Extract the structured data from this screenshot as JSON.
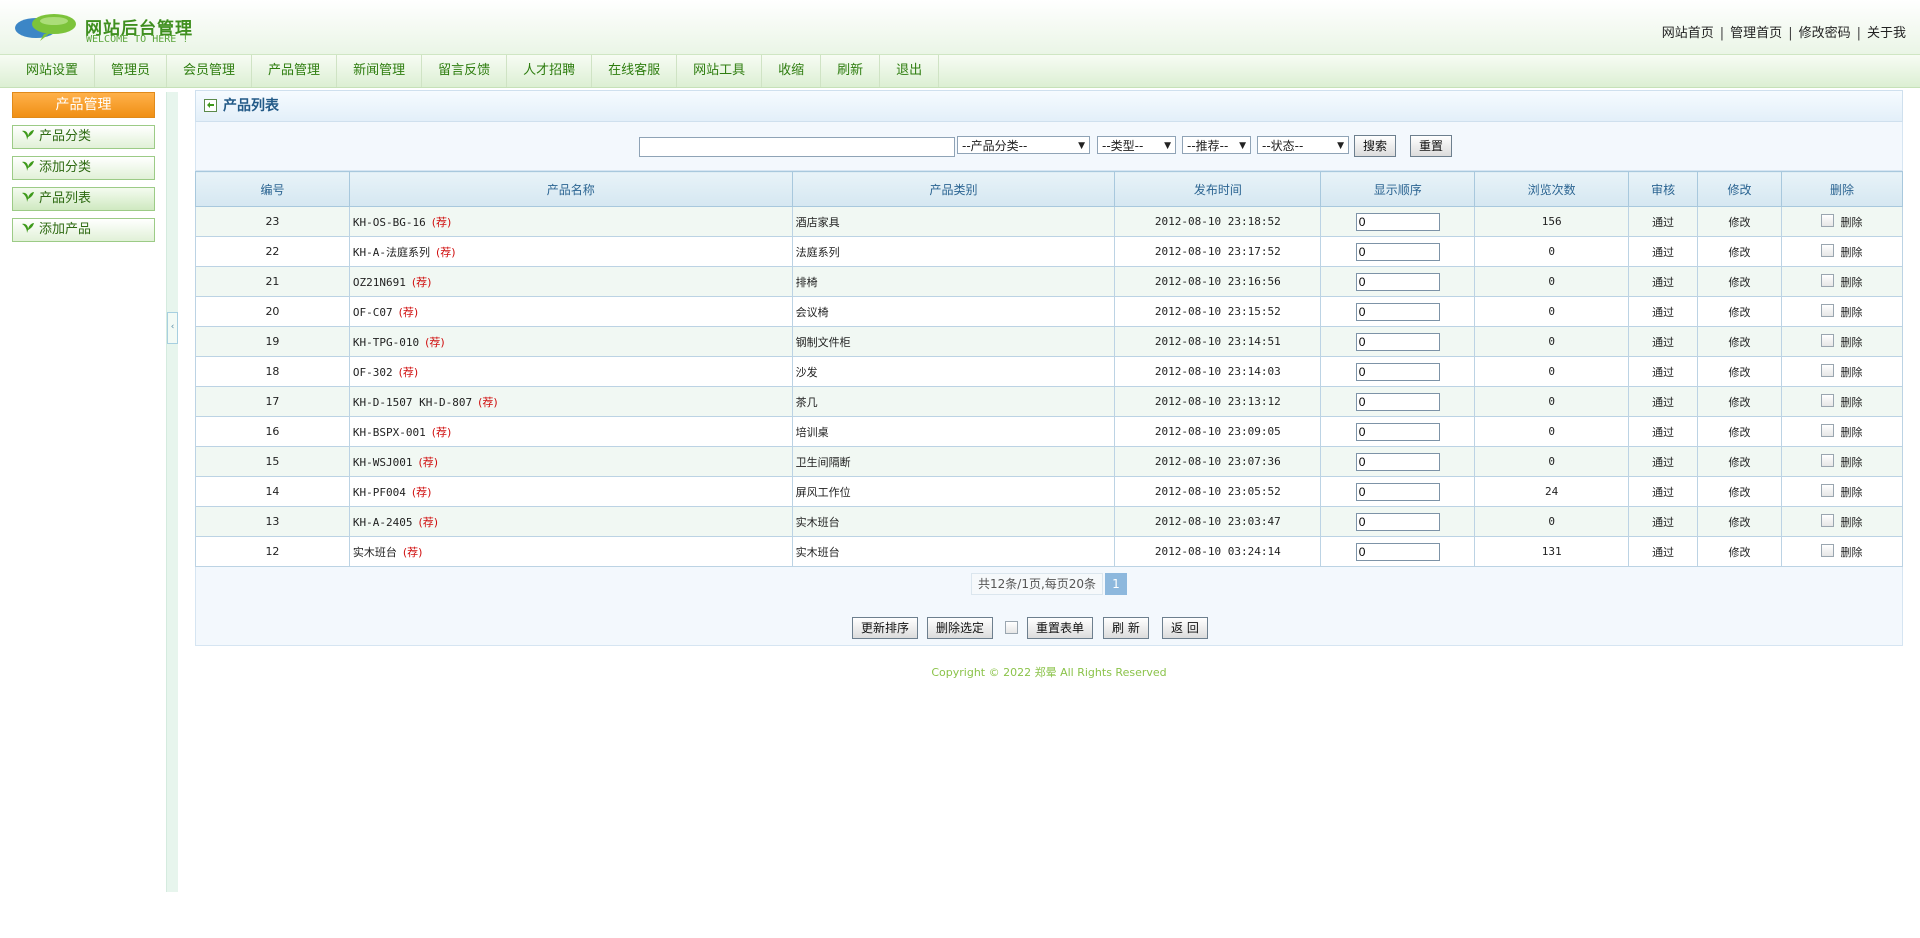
{
  "header": {
    "title": "网站后台管理",
    "subtitle": "WELCOME TO HERE !",
    "links": [
      "网站首页",
      "管理首页",
      "修改密码",
      "关于我"
    ]
  },
  "nav": [
    "网站设置",
    "管理员",
    "会员管理",
    "产品管理",
    "新闻管理",
    "留言反馈",
    "人才招聘",
    "在线客服",
    "网站工具",
    "收缩",
    "刷新",
    "退出"
  ],
  "sidebar": {
    "title": "产品管理",
    "items": [
      "产品分类",
      "添加分类",
      "产品列表",
      "添加产品"
    ],
    "collapse_glyph": "‹"
  },
  "panel": {
    "title": "产品列表"
  },
  "search": {
    "keyword_value": "",
    "category": "--产品分类--",
    "type": "--类型--",
    "recommend": "--推荐--",
    "status": "--状态--",
    "search_label": "搜索",
    "reset_label": "重置"
  },
  "columns": [
    "编号",
    "产品名称",
    "产品类别",
    "发布时间",
    "显示顺序",
    "浏览次数",
    "审核",
    "修改",
    "删除"
  ],
  "rows": [
    {
      "id": "23",
      "name": "KH-OS-BG-16",
      "rec": "(荐)",
      "category": "酒店家具",
      "time": "2012-08-10 23:18:52",
      "order": "0",
      "views": "156",
      "audit": "通过",
      "edit": "修改",
      "del": "删除"
    },
    {
      "id": "22",
      "name": "KH-A-法庭系列",
      "rec": "(荐)",
      "category": "法庭系列",
      "time": "2012-08-10 23:17:52",
      "order": "0",
      "views": "0",
      "audit": "通过",
      "edit": "修改",
      "del": "删除"
    },
    {
      "id": "21",
      "name": "OZ21N691",
      "rec": "(荐)",
      "category": "排椅",
      "time": "2012-08-10 23:16:56",
      "order": "0",
      "views": "0",
      "audit": "通过",
      "edit": "修改",
      "del": "删除"
    },
    {
      "id": "20",
      "name": "OF-C07",
      "rec": "(荐)",
      "category": "会议椅",
      "time": "2012-08-10 23:15:52",
      "order": "0",
      "views": "0",
      "audit": "通过",
      "edit": "修改",
      "del": "删除"
    },
    {
      "id": "19",
      "name": "KH-TPG-010",
      "rec": "(荐)",
      "category": "钢制文件柜",
      "time": "2012-08-10 23:14:51",
      "order": "0",
      "views": "0",
      "audit": "通过",
      "edit": "修改",
      "del": "删除"
    },
    {
      "id": "18",
      "name": "OF-302",
      "rec": "(荐)",
      "category": "沙发",
      "time": "2012-08-10 23:14:03",
      "order": "0",
      "views": "0",
      "audit": "通过",
      "edit": "修改",
      "del": "删除"
    },
    {
      "id": "17",
      "name": "KH-D-1507 KH-D-807",
      "rec": "(荐)",
      "category": "茶几",
      "time": "2012-08-10 23:13:12",
      "order": "0",
      "views": "0",
      "audit": "通过",
      "edit": "修改",
      "del": "删除"
    },
    {
      "id": "16",
      "name": "KH-BSPX-001",
      "rec": "(荐)",
      "category": "培训桌",
      "time": "2012-08-10 23:09:05",
      "order": "0",
      "views": "0",
      "audit": "通过",
      "edit": "修改",
      "del": "删除"
    },
    {
      "id": "15",
      "name": "KH-WSJ001",
      "rec": "(荐)",
      "category": "卫生间隔断",
      "time": "2012-08-10 23:07:36",
      "order": "0",
      "views": "0",
      "audit": "通过",
      "edit": "修改",
      "del": "删除"
    },
    {
      "id": "14",
      "name": "KH-PF004",
      "rec": "(荐)",
      "category": "屏风工作位",
      "time": "2012-08-10 23:05:52",
      "order": "0",
      "views": "24",
      "audit": "通过",
      "edit": "修改",
      "del": "删除"
    },
    {
      "id": "13",
      "name": "KH-A-2405",
      "rec": "(荐)",
      "category": "实木班台",
      "time": "2012-08-10 23:03:47",
      "order": "0",
      "views": "0",
      "audit": "通过",
      "edit": "修改",
      "del": "删除"
    },
    {
      "id": "12",
      "name": "实木班台",
      "rec": "(荐)",
      "category": "实木班台",
      "time": "2012-08-10 03:24:14",
      "order": "0",
      "views": "131",
      "audit": "通过",
      "edit": "修改",
      "del": "删除"
    }
  ],
  "pager": {
    "info": "共12条/1页,每页20条",
    "current": "1"
  },
  "actions": {
    "update_order": "更新排序",
    "delete_selected": "删除选定",
    "reset_form": "重置表单",
    "refresh": "刷 新",
    "back": "返 回"
  },
  "copyright": "Copyright © 2022  郑晕  All Rights Reserved",
  "colors": {
    "accent_green": "#3f8f1f",
    "sidebar_head": "#f39a24",
    "recommend": "#d01010"
  }
}
